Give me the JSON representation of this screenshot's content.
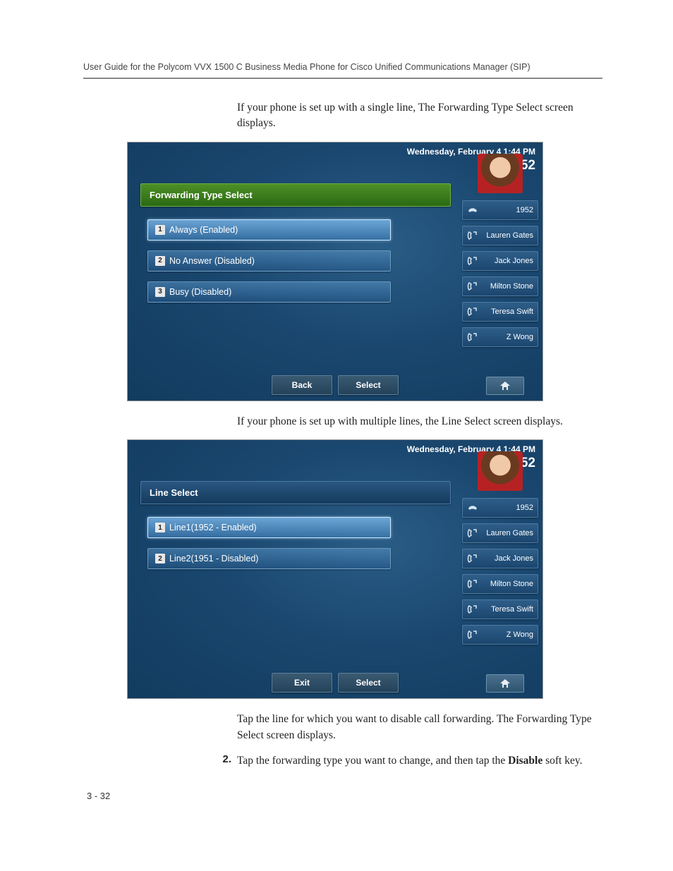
{
  "header": "User Guide for the Polycom VVX 1500 C Business Media Phone for Cisco Unified Communications Manager (SIP)",
  "para1": "If your phone is set up with a single line, The Forwarding Type Select screen displays.",
  "para2": "If your phone is set up with multiple lines, the Line Select screen displays.",
  "para3": "Tap the line for which you want to disable call forwarding. The Forwarding Type Select screen displays.",
  "step2_num": "2.",
  "step2_a": "Tap the forwarding type you want to change, and then tap the ",
  "step2_bold": "Disable",
  "step2_b": " soft key.",
  "page_number": "3 - 32",
  "shot1": {
    "datetime": "Wednesday, February 4  1:44 PM",
    "ext": "1952",
    "title": "Forwarding Type Select",
    "rows": [
      {
        "n": "1",
        "label": "Always (Enabled)"
      },
      {
        "n": "2",
        "label": "No Answer (Disabled)"
      },
      {
        "n": "3",
        "label": "Busy (Disabled)"
      }
    ],
    "softkeys": {
      "left": "Back",
      "right": "Select"
    },
    "side_ext": "1952",
    "contacts": [
      "Lauren Gates",
      "Jack Jones",
      "Milton Stone",
      "Teresa Swift",
      "Z Wong"
    ]
  },
  "shot2": {
    "datetime": "Wednesday, February 4  1:44 PM",
    "ext": "1952",
    "title": "Line Select",
    "rows": [
      {
        "n": "1",
        "label": "Line1(1952 - Enabled)"
      },
      {
        "n": "2",
        "label": "Line2(1951 - Disabled)"
      }
    ],
    "softkeys": {
      "left": "Exit",
      "right": "Select"
    },
    "side_ext": "1952",
    "contacts": [
      "Lauren Gates",
      "Jack Jones",
      "Milton Stone",
      "Teresa Swift",
      "Z Wong"
    ]
  }
}
